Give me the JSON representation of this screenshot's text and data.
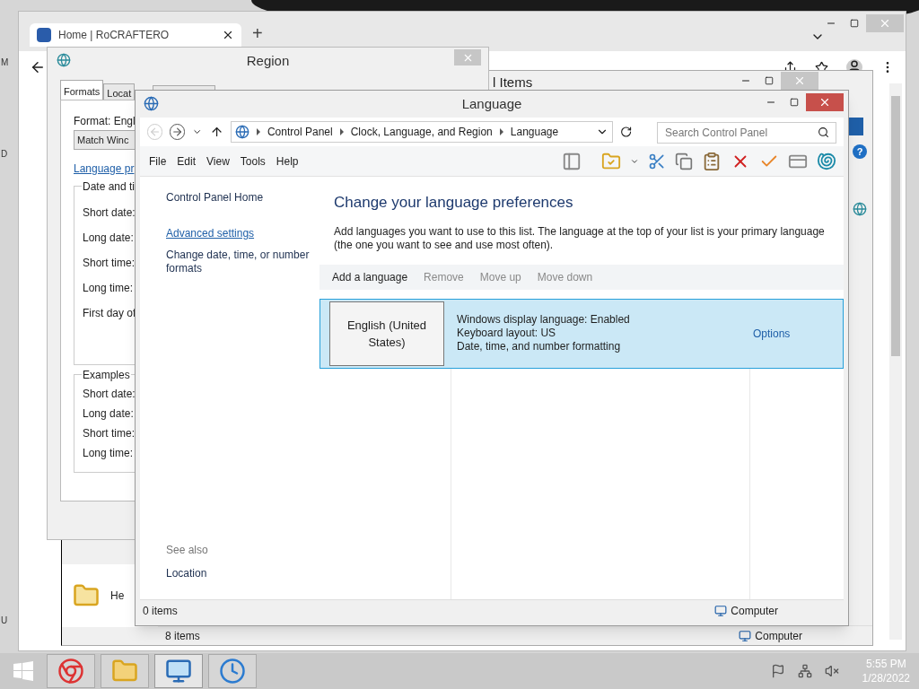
{
  "desktop_labels": [
    "M",
    "D",
    "U"
  ],
  "browser": {
    "tab_title": "Home | RoCRAFTERO",
    "new_tab": "+"
  },
  "back_window": {
    "title": "l Items",
    "help": "?",
    "file_label": "He",
    "status_items": "8 items",
    "status_location": "Computer"
  },
  "region": {
    "title": "Region",
    "tabs": [
      {
        "label": "Formats",
        "selected": true
      },
      {
        "label": "Locat",
        "selected": false
      }
    ],
    "format_label": "Format: Engl",
    "format_value": "Match Winc",
    "link": "Language pr",
    "groups": [
      {
        "title": "Date and ti",
        "rows": [
          "Short date:",
          "Long date:",
          "Short time:",
          "Long time:",
          "First day of"
        ]
      },
      {
        "title": "Examples",
        "rows": [
          "Short date:",
          "Long date:",
          "Short time:",
          "Long time:"
        ]
      }
    ]
  },
  "language": {
    "title": "Language",
    "breadcrumb": [
      "Control Panel",
      "Clock, Language, and Region",
      "Language"
    ],
    "search_placeholder": "Search Control Panel",
    "menu": [
      "File",
      "Edit",
      "View",
      "Tools",
      "Help"
    ],
    "sidebar": {
      "home": "Control Panel Home",
      "links": [
        {
          "label": "Advanced settings",
          "kind": "link"
        },
        {
          "label": "Change date, time, or number formats",
          "kind": "text"
        }
      ],
      "see_also_title": "See also",
      "see_also": [
        "Location"
      ]
    },
    "heading": "Change your language preferences",
    "description": "Add languages you want to use to this list. The language at the top of your list is your primary language (the one you want to see and use most often).",
    "actions": [
      {
        "label": "Add a language",
        "disabled": false
      },
      {
        "label": "Remove",
        "disabled": true
      },
      {
        "label": "Move up",
        "disabled": true
      },
      {
        "label": "Move down",
        "disabled": true
      }
    ],
    "languages": [
      {
        "name": "English (United States)",
        "details": [
          "Windows display language: Enabled",
          "Keyboard layout: US",
          "Date, time, and number formatting"
        ],
        "options": "Options",
        "selected": true
      }
    ],
    "status": {
      "items": "0 items",
      "location": "Computer"
    }
  },
  "taskbar": {
    "apps": [
      {
        "kind": "chrome",
        "selected": false
      },
      {
        "kind": "explorer",
        "selected": false
      },
      {
        "kind": "control-panel",
        "selected": true
      },
      {
        "kind": "clock",
        "selected": false
      }
    ],
    "time": "5:55 PM",
    "date": "1/28/2022"
  }
}
